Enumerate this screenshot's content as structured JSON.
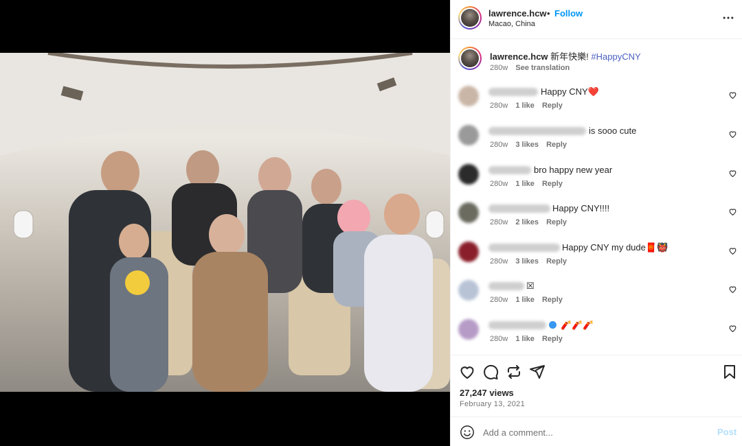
{
  "post": {
    "username": "lawrence.hcw",
    "separator": "•",
    "follow_label": "Follow",
    "location": "Macao, China",
    "more_icon": "more-horizontal-icon"
  },
  "caption": {
    "username": "lawrence.hcw",
    "text": "新年快樂!",
    "hashtag": "#HappyCNY",
    "time": "280w",
    "see_translation": "See translation"
  },
  "comments": [
    {
      "text": "Happy CNY❤️",
      "time": "280w",
      "likes": "1 like",
      "reply": "Reply",
      "avatar_color": "#c9b6a6"
    },
    {
      "text": "is sooo cute",
      "time": "280w",
      "likes": "3 likes",
      "reply": "Reply",
      "avatar_color": "#9a9a9a"
    },
    {
      "text": "bro happy new year",
      "time": "280w",
      "likes": "1 like",
      "reply": "Reply",
      "avatar_color": "#2b2b2b"
    },
    {
      "text": "Happy CNY!!!!",
      "time": "280w",
      "likes": "2 likes",
      "reply": "Reply",
      "avatar_color": "#6b6b60"
    },
    {
      "text": "Happy CNY my dude🧧👹",
      "time": "280w",
      "likes": "3 likes",
      "reply": "Reply",
      "avatar_color": "#8a1f2b"
    },
    {
      "text": "☒",
      "time": "280w",
      "likes": "1 like",
      "reply": "Reply",
      "avatar_color": "#b8c4d6"
    },
    {
      "text": "🧨🧨🧨",
      "time": "280w",
      "likes": "1 like",
      "reply": "Reply",
      "avatar_color": "#b69bc7"
    }
  ],
  "stats": {
    "views": "27,247 views",
    "date": "February 13, 2021"
  },
  "composer": {
    "placeholder": "Add a comment...",
    "post_label": "Post"
  },
  "colors": {
    "accent": "#0095f6",
    "hashtag": "#4a5fc1",
    "muted": "#737373",
    "post_disabled": "#b2dffc"
  }
}
